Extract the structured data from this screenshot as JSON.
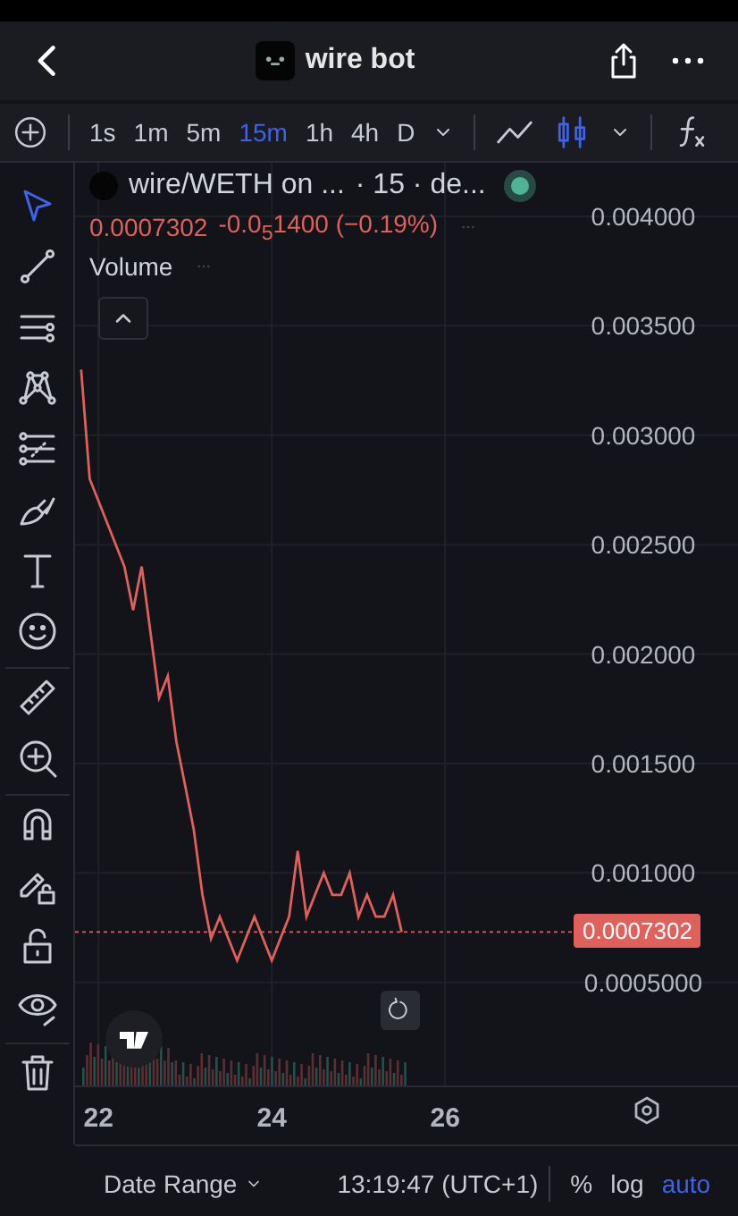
{
  "header": {
    "title": "wire bot"
  },
  "toolbar": {
    "intervals": [
      {
        "label": "1s",
        "selected": false
      },
      {
        "label": "1m",
        "selected": false
      },
      {
        "label": "5m",
        "selected": false
      },
      {
        "label": "15m",
        "selected": true
      },
      {
        "label": "1h",
        "selected": false
      },
      {
        "label": "4h",
        "selected": false
      },
      {
        "label": "D",
        "selected": false
      }
    ],
    "chart_types": [
      {
        "kind": "line",
        "selected": false
      },
      {
        "kind": "candles",
        "selected": true
      }
    ]
  },
  "sidebar": {
    "tool_groups": [
      [
        {
          "kind": "cursor",
          "selected": true
        },
        {
          "kind": "trendline",
          "selected": false
        },
        {
          "kind": "hlines",
          "selected": false
        },
        {
          "kind": "pattern",
          "selected": false
        },
        {
          "kind": "fib",
          "selected": false
        },
        {
          "kind": "brush",
          "selected": false
        },
        {
          "kind": "text",
          "selected": false
        },
        {
          "kind": "emoji",
          "selected": false
        }
      ],
      [
        {
          "kind": "ruler",
          "selected": false
        },
        {
          "kind": "zoom",
          "selected": false
        }
      ],
      [
        {
          "kind": "magnet",
          "selected": false
        },
        {
          "kind": "lockdraw",
          "selected": false
        },
        {
          "kind": "lock",
          "selected": false
        },
        {
          "kind": "eye",
          "selected": false
        }
      ],
      [
        {
          "kind": "trash",
          "selected": false
        }
      ]
    ]
  },
  "legend": {
    "symbol": "wire/WETH on ...",
    "interval": "· 15 · de...",
    "price": "0.0007302",
    "change": "-0.0$_{5}$1400 (−0.19%)",
    "volume_label": "Volume"
  },
  "price_badge": "0.0007302",
  "chart": {
    "chart_data": {
      "type": "line",
      "x": [
        21.8,
        21.9,
        22.0,
        22.1,
        22.2,
        22.3,
        22.4,
        22.5,
        22.6,
        22.7,
        22.8,
        22.9,
        23.0,
        23.1,
        23.2,
        23.3,
        23.4,
        23.5,
        23.6,
        23.7,
        23.8,
        23.9,
        24.0,
        24.1,
        24.2,
        24.3,
        24.4,
        24.5,
        24.6,
        24.7,
        24.8,
        24.9,
        25.0,
        25.1,
        25.2,
        25.3,
        25.4,
        25.5
      ],
      "series": [
        {
          "color": "#e0605c",
          "values": [
            0.0033,
            0.0028,
            0.0027,
            0.0026,
            0.0025,
            0.0024,
            0.0022,
            0.0024,
            0.0021,
            0.0018,
            0.0019,
            0.0016,
            0.0014,
            0.0012,
            0.0009,
            0.0007,
            0.0008,
            0.0007,
            0.0006,
            0.0007,
            0.0008,
            0.0007,
            0.0006,
            0.0007,
            0.0008,
            0.0011,
            0.0008,
            0.0009,
            0.001,
            0.0009,
            0.0009,
            0.001,
            0.0008,
            0.0009,
            0.0008,
            0.0008,
            0.0009,
            0.00073
          ]
        }
      ],
      "xlim": [
        21.73,
        29.38
      ],
      "ylim": [
        2.9e-05,
        0.004245
      ],
      "grid": true,
      "ref_lines": [
        {
          "axis": "y",
          "value": 0.0007302,
          "color": "#e0605c"
        }
      ],
      "xticks": [
        {
          "value": 22,
          "label": "22"
        },
        {
          "value": 24,
          "label": "24"
        },
        {
          "value": 26,
          "label": "26"
        }
      ],
      "yticks": [
        {
          "value": 0.004,
          "label": "0.004000"
        },
        {
          "value": 0.0035,
          "label": "0.003500"
        },
        {
          "value": 0.003,
          "label": "0.003000"
        },
        {
          "value": 0.0025,
          "label": "0.002500"
        },
        {
          "value": 0.002,
          "label": "0.002000"
        },
        {
          "value": 0.0015,
          "label": "0.001500"
        },
        {
          "value": 0.001,
          "label": "0.001000"
        },
        {
          "value": 0.0005,
          "label": "0.0005000"
        }
      ]
    }
  },
  "bottom_bar": {
    "date_range": "Date Range",
    "time": "13:19:47 (UTC+1)",
    "scale_options": [
      {
        "label": "%",
        "selected": false
      },
      {
        "label": "log",
        "selected": false
      },
      {
        "label": "auto",
        "selected": true
      }
    ]
  }
}
